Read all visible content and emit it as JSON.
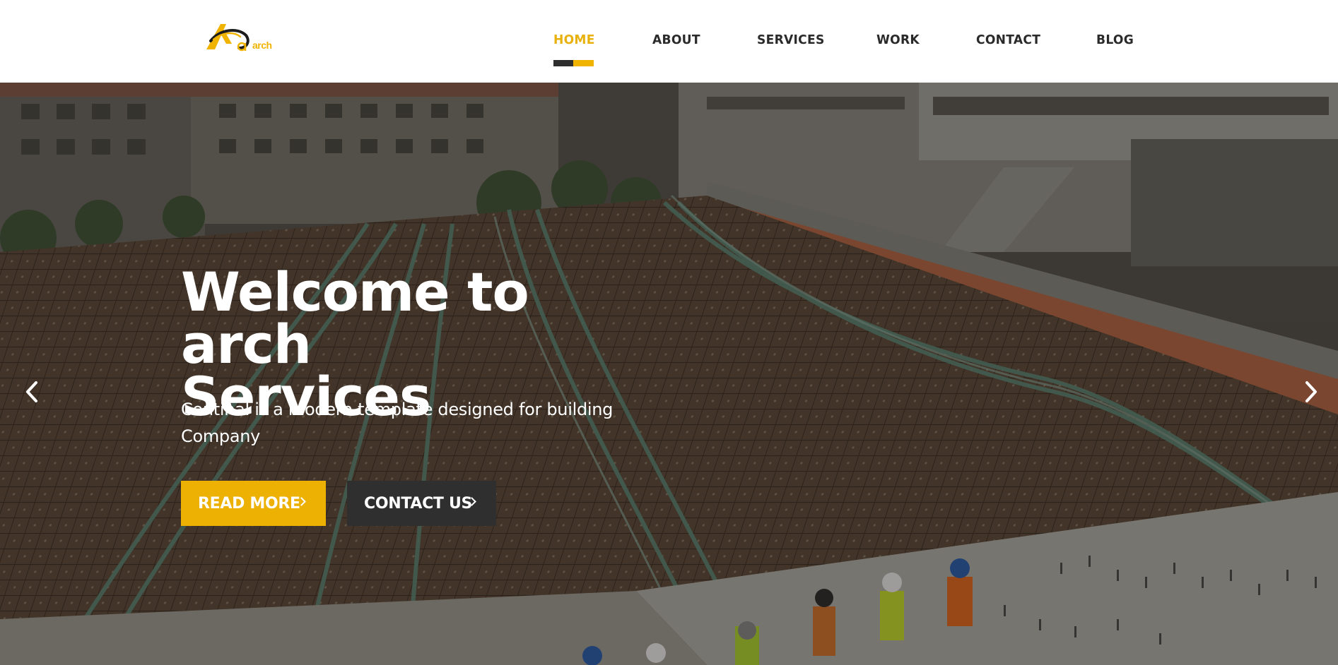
{
  "brand": {
    "logo_text": "arch",
    "accent_color": "#f0b400",
    "dark_color": "#2e2e2e"
  },
  "nav": {
    "items": [
      {
        "label": "HOME",
        "active": true
      },
      {
        "label": "ABOUT",
        "active": false
      },
      {
        "label": "SERVICES",
        "active": false
      },
      {
        "label": "WORK",
        "active": false
      },
      {
        "label": "CONTACT",
        "active": false
      },
      {
        "label": "BLOG",
        "active": false
      }
    ]
  },
  "hero": {
    "title_line1": "Welcome to arch",
    "title_line2": "Services",
    "subtitle_line1": "Continal is a modern template designed for building",
    "subtitle_line2": "Company",
    "read_more_label": "READ MORE",
    "contact_label": "CONTACT US",
    "prev_icon": "chevron-left-icon",
    "next_icon": "chevron-right-icon"
  }
}
